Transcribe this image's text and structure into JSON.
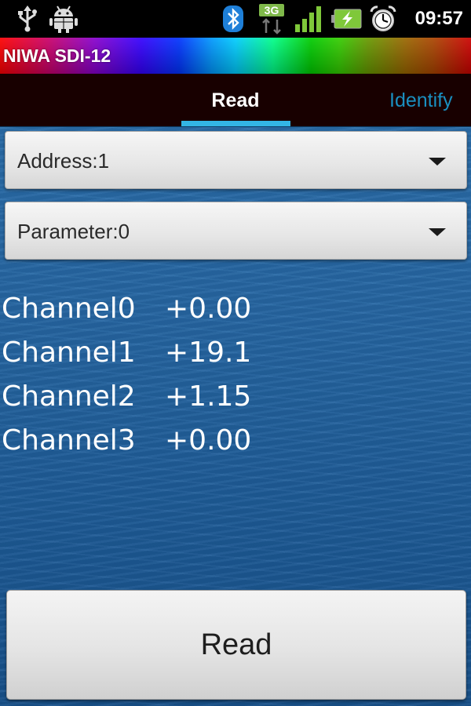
{
  "status_bar": {
    "icons": [
      "usb-icon",
      "android-debug-icon",
      "bluetooth-icon",
      "3g-data-icon",
      "signal-strength-icon",
      "battery-charging-icon",
      "alarm-clock-icon"
    ],
    "network_label": "3G",
    "time": "09:57"
  },
  "app": {
    "title": "NIWA SDI-12"
  },
  "tabs": [
    {
      "label": "Read",
      "selected": true
    },
    {
      "label": "Identify",
      "selected": false
    }
  ],
  "address_spinner": {
    "value": "Address:1"
  },
  "parameter_spinner": {
    "value": "Parameter:0"
  },
  "channels": [
    {
      "name": "Channel0",
      "value": "+0.00"
    },
    {
      "name": "Channel1",
      "value": "+19.1"
    },
    {
      "name": "Channel2",
      "value": "+1.15"
    },
    {
      "name": "Channel3",
      "value": "+0.00"
    }
  ],
  "read_button": {
    "label": "Read"
  },
  "colors": {
    "tab_indicator": "#33b5e5",
    "tab_inactive_text": "#1a8fc0",
    "tab_bar_bg": "#180000",
    "water_bg": "#1f5f9c"
  }
}
